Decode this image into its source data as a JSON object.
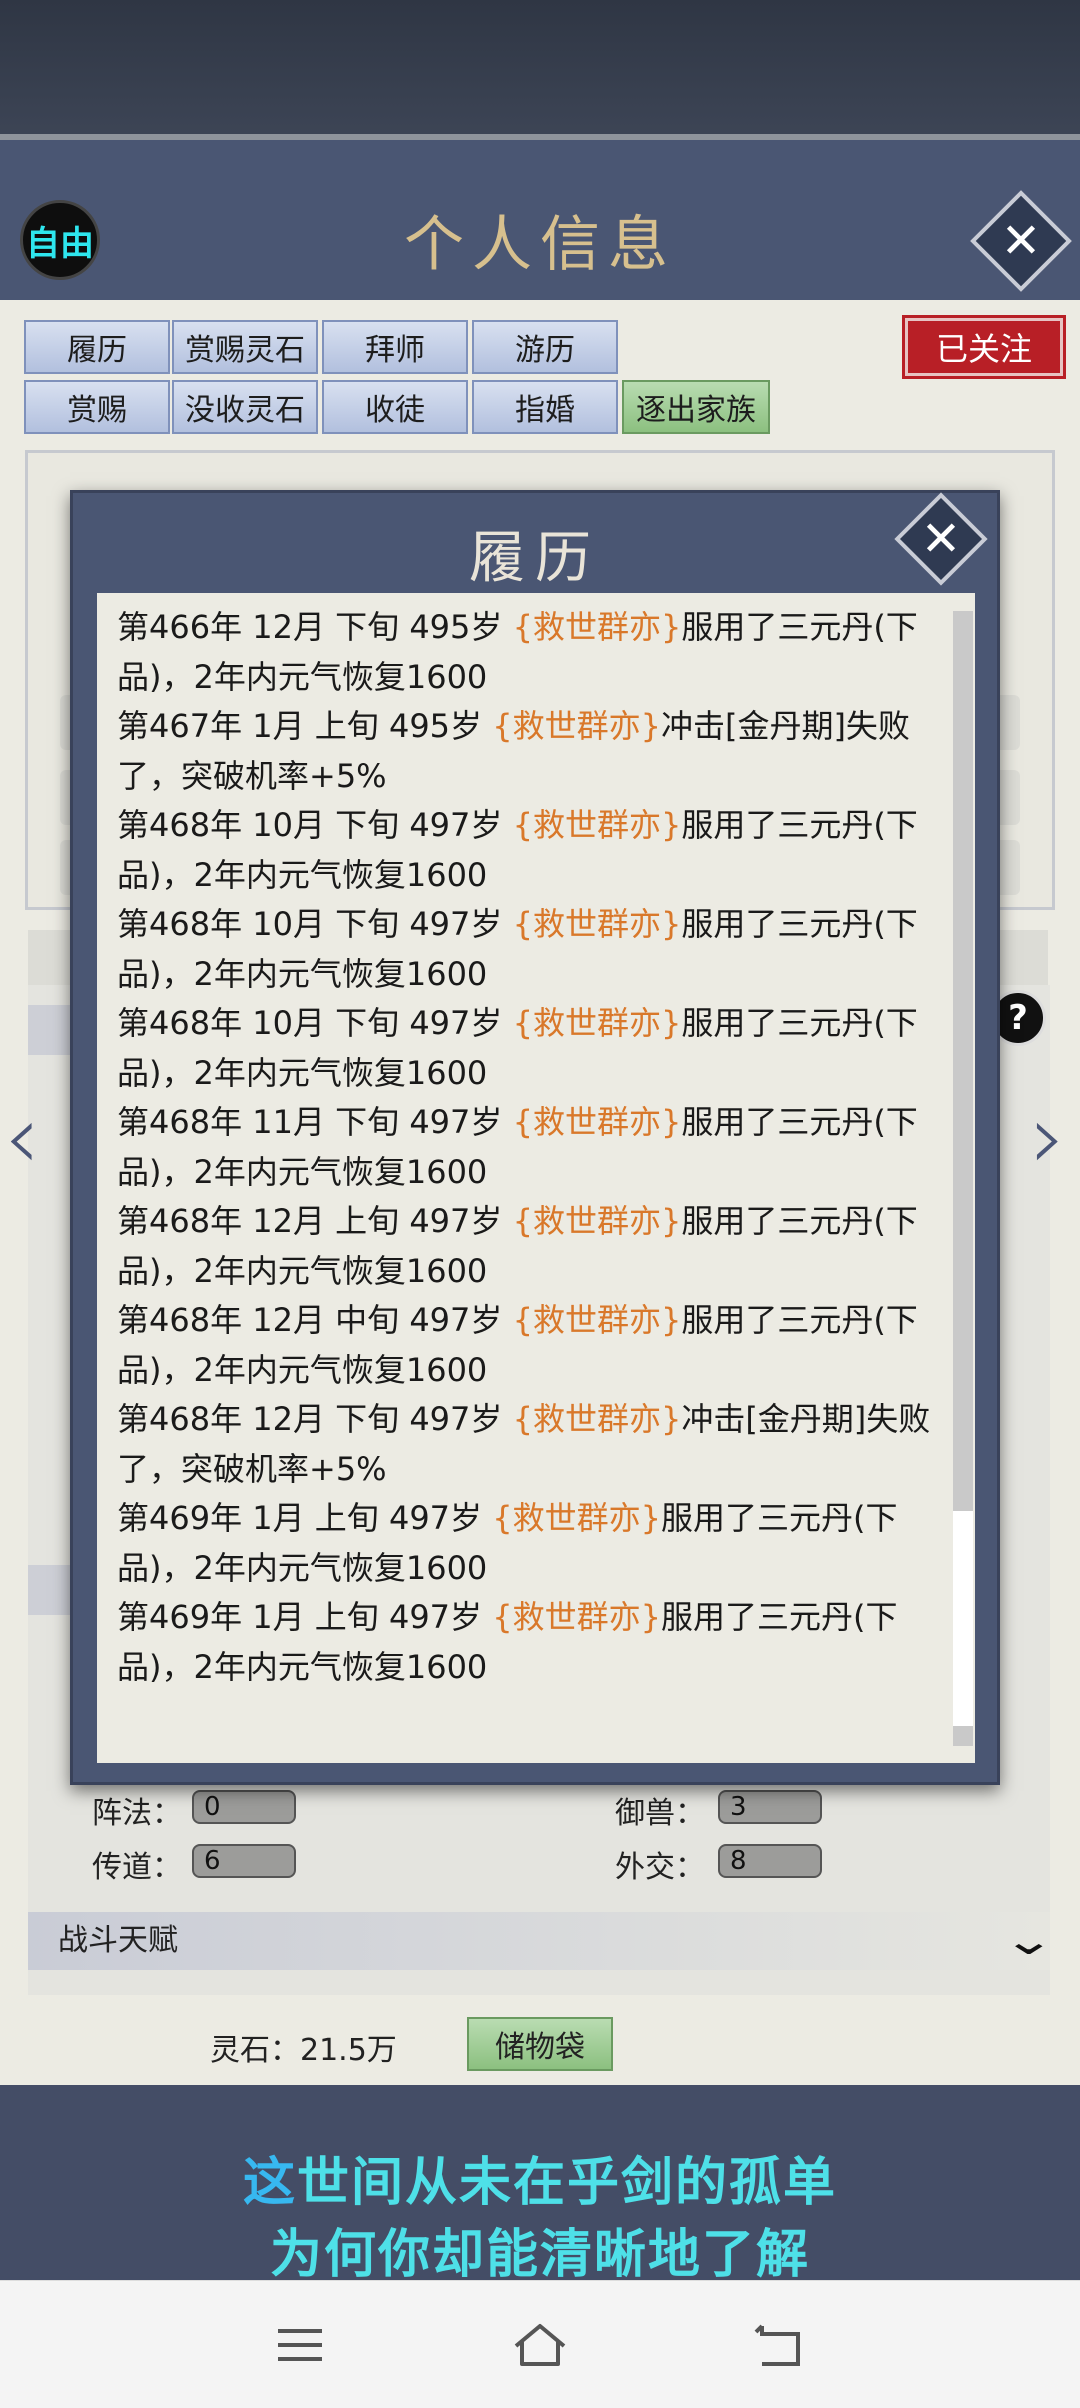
{
  "header": {
    "free_badge": "自由",
    "title": "个人信息"
  },
  "tabs_row1": [
    "履历",
    "赏赐灵石",
    "拜师",
    "游历"
  ],
  "tabs_row2": [
    "赏赐",
    "没收灵石",
    "收徒",
    "指婚",
    "逐出家族"
  ],
  "followed_label": "已关注",
  "stats": {
    "formation_label": "阵法：",
    "formation_value": "0",
    "beast_label": "御兽：",
    "beast_value": "3",
    "preach_label": "传道：",
    "preach_value": "6",
    "diplomacy_label": "外交：",
    "diplomacy_value": "8"
  },
  "battle_talent_label": "战斗天赋",
  "spirit_stone": "灵石：21.5万",
  "storage_button": "储物袋",
  "subtitles": {
    "line1_first": "这",
    "line1_rest": "世间从未在乎剑的孤单",
    "line2": "为何你却能清晰地了解"
  },
  "modal": {
    "title": "履历",
    "entries": [
      {
        "prefix": "第466年 12月 下旬 495岁 ",
        "name": "{救世群亦}",
        "suffix": "服用了三元丹(下品)，2年内元气恢复1600"
      },
      {
        "prefix": "第467年 1月 上旬 495岁 ",
        "name": "{救世群亦}",
        "suffix": "冲击[金丹期]失败了，突破机率+5%"
      },
      {
        "prefix": "第468年 10月 下旬 497岁 ",
        "name": "{救世群亦}",
        "suffix": "服用了三元丹(下品)，2年内元气恢复1600"
      },
      {
        "prefix": "第468年 10月 下旬 497岁 ",
        "name": "{救世群亦}",
        "suffix": "服用了三元丹(下品)，2年内元气恢复1600"
      },
      {
        "prefix": "第468年 10月 下旬 497岁 ",
        "name": "{救世群亦}",
        "suffix": "服用了三元丹(下品)，2年内元气恢复1600"
      },
      {
        "prefix": "第468年 11月 下旬 497岁 ",
        "name": "{救世群亦}",
        "suffix": "服用了三元丹(下品)，2年内元气恢复1600"
      },
      {
        "prefix": "第468年 12月 上旬 497岁 ",
        "name": "{救世群亦}",
        "suffix": "服用了三元丹(下品)，2年内元气恢复1600"
      },
      {
        "prefix": "第468年 12月 中旬 497岁 ",
        "name": "{救世群亦}",
        "suffix": "服用了三元丹(下品)，2年内元气恢复1600"
      },
      {
        "prefix": "第468年 12月 下旬 497岁 ",
        "name": "{救世群亦}",
        "suffix": "冲击[金丹期]失败了，突破机率+5%"
      },
      {
        "prefix": "第469年 1月 上旬 497岁 ",
        "name": "{救世群亦}",
        "suffix": "服用了三元丹(下品)，2年内元气恢复1600"
      },
      {
        "prefix": "第469年 1月 上旬 497岁 ",
        "name": "{救世群亦}",
        "suffix": "服用了三元丹(下品)，2年内元气恢复1600"
      }
    ]
  },
  "navbar": {
    "menu_icon": "menu-icon",
    "home_icon": "home-icon",
    "back_icon": "back-icon"
  },
  "colors": {
    "accent_name": "#d9782a",
    "panel_blue": "#4a5673",
    "follow_red": "#b81f26",
    "subtitle_cyan": "#4ee0e8"
  }
}
